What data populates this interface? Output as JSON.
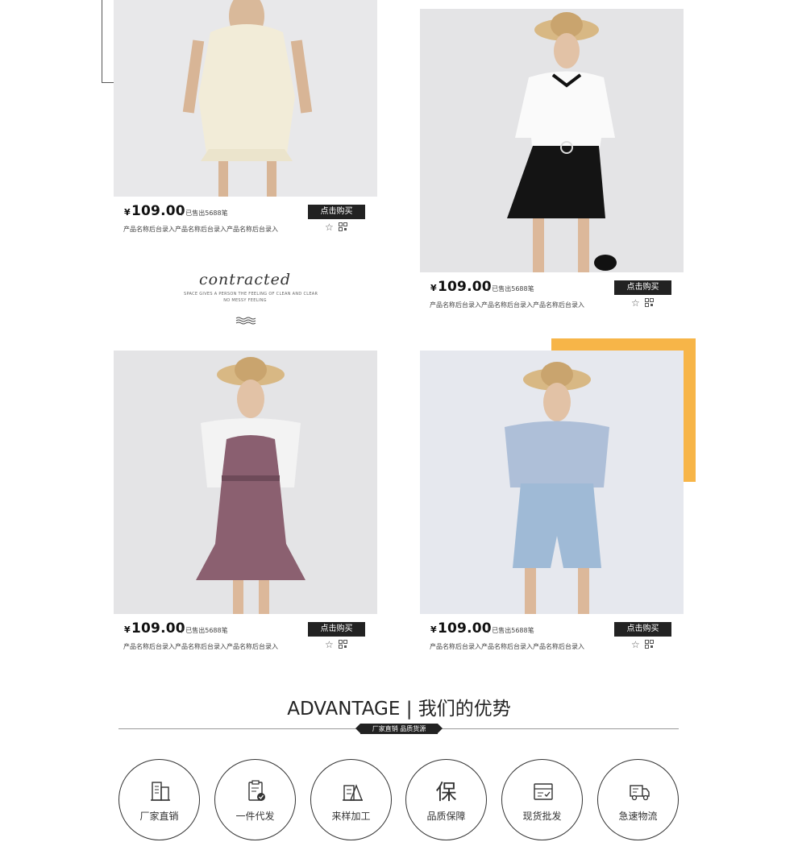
{
  "products": [
    {
      "currency": "¥",
      "price": "109.00",
      "sold": "/ 已售出5688笔",
      "buy_label": "点击购买",
      "name": "产品名称后台录入产品名称后台录入产品名称后台录入"
    },
    {
      "currency": "¥",
      "price": "109.00",
      "sold": "/ 已售出5688笔",
      "buy_label": "点击购买",
      "name": "产品名称后台录入产品名称后台录入产品名称后台录入"
    },
    {
      "currency": "¥",
      "price": "109.00",
      "sold": "/ 已售出5688笔",
      "buy_label": "点击购买",
      "name": "产品名称后台录入产品名称后台录入产品名称后台录入"
    },
    {
      "currency": "¥",
      "price": "109.00",
      "sold": "/ 已售出5688笔",
      "buy_label": "点击购买",
      "name": "产品名称后台录入产品名称后台录入产品名称后台录入"
    }
  ],
  "contracted": {
    "script": "contracted",
    "line1": "SPACE GIVES A PERSON THE FEELING OF CLEAN AND CLEAR",
    "line2": "NO MESSY FEELING"
  },
  "advantage": {
    "title": "ADVANTAGE | 我们的优势",
    "badge": "厂家直销 品质货源",
    "items": [
      {
        "label": "厂家直销",
        "icon": "building-icon"
      },
      {
        "label": "一件代发",
        "icon": "clipboard-check-icon"
      },
      {
        "label": "来样加工",
        "icon": "sample-process-icon"
      },
      {
        "label": "品质保障",
        "icon": "bao-char-icon",
        "glyph": "保"
      },
      {
        "label": "现货批发",
        "icon": "box-check-icon"
      },
      {
        "label": "急速物流",
        "icon": "delivery-truck-icon"
      }
    ]
  },
  "colors": {
    "accent": "#f7b548",
    "dark": "#222222"
  }
}
